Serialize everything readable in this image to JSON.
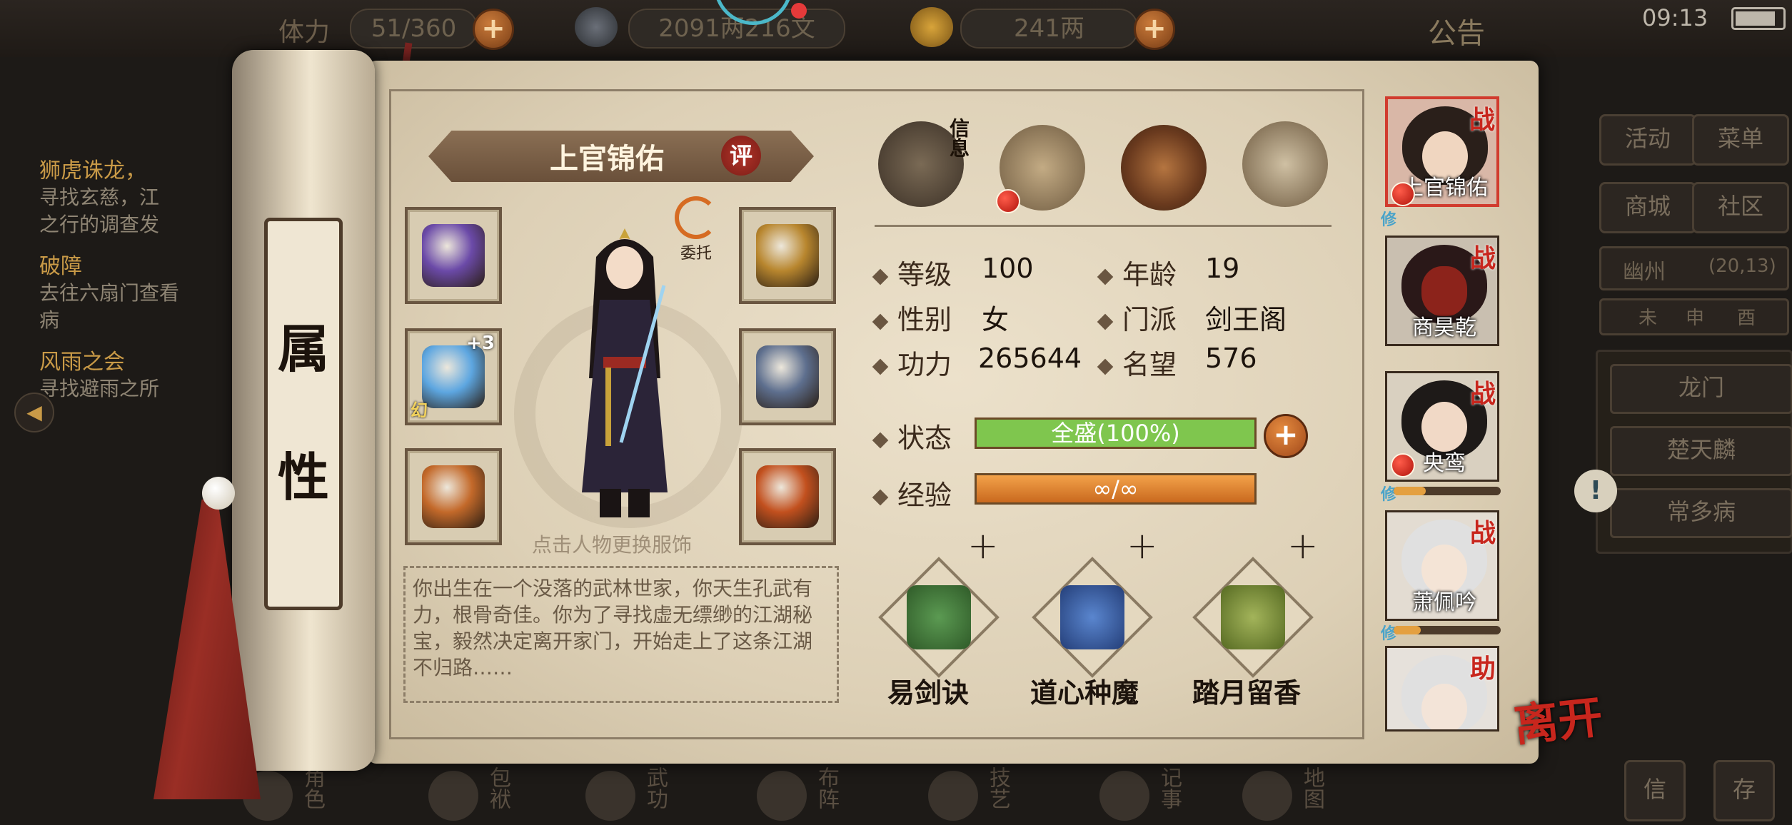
{
  "topbar": {
    "stamina_label": "体力",
    "stamina_value": "51/360",
    "money_value": "2091两216文",
    "gold_value": "241两",
    "notice_label": "公告",
    "clock": "09:13"
  },
  "quests": [
    {
      "title": "狮虎诛龙，",
      "desc": "寻找玄慈，江\n之行的调查发"
    },
    {
      "title": "破障",
      "desc": "去往六扇门查看\n病"
    },
    {
      "title": "风雨之会",
      "desc": "寻找避雨之所"
    }
  ],
  "scroll_tab": {
    "line1": "属",
    "line2": "性"
  },
  "character": {
    "name": "上官锦佑",
    "review_label": "评",
    "delegate_label": "委托",
    "hint": "点击人物更换服饰",
    "bio": "你出生在一个没落的武林世家，你天生孔武有力，根骨奇佳。你为了寻找虚无缥缈的江湖秘宝，毅然决定离开家门，开始走上了这条江湖不归路……"
  },
  "equipment": {
    "left": [
      {
        "icon": "gauntlet-icon",
        "color": "#6b4aa8"
      },
      {
        "icon": "sword-icon",
        "color": "#5da6e0",
        "badge": "+3",
        "badge2": "幻"
      },
      {
        "icon": "ring-icon",
        "color": "#c3692a"
      }
    ],
    "right": [
      {
        "icon": "bracelet-icon",
        "color": "#b8862e"
      },
      {
        "icon": "armor-icon",
        "color": "#5e6f8e"
      },
      {
        "icon": "amulet-icon",
        "color": "#c2501e"
      }
    ]
  },
  "tabs": [
    {
      "name": "info",
      "label": "信息",
      "color": "#6a5641"
    },
    {
      "name": "map",
      "label": "",
      "color": "#a08a6a"
    },
    {
      "name": "bagua",
      "label": "",
      "color": "#7a4a2a"
    },
    {
      "name": "meridian",
      "label": "",
      "color": "#a08a6a"
    }
  ],
  "stats": {
    "level_label": "等级",
    "level_value": "100",
    "age_label": "年龄",
    "age_value": "19",
    "gender_label": "性别",
    "gender_value": "女",
    "sect_label": "门派",
    "sect_value": "剑王阁",
    "power_label": "功力",
    "power_value": "265644",
    "fame_label": "名望",
    "fame_value": "576",
    "status_label": "状态",
    "status_value": "全盛(100%)",
    "status_fraction": 1.0,
    "exp_label": "经验",
    "exp_value": "∞/∞"
  },
  "skills": [
    {
      "name": "易剑诀",
      "color": "#3f7a3a"
    },
    {
      "name": "道心种魔",
      "color": "#3a5fa6"
    },
    {
      "name": "踏月留香",
      "color": "#6f8a3a"
    }
  ],
  "roster": [
    {
      "name": "上官锦佑",
      "role": "战",
      "selected": true,
      "face": "#2a1f1a",
      "skin": "#f0d6c0",
      "xiu": "修"
    },
    {
      "name": "商昊乾",
      "role": "战",
      "selected": false,
      "face": "#3a1a1a",
      "skin": "#9a2a20",
      "xiu": ""
    },
    {
      "name": "央鸾",
      "role": "战",
      "selected": false,
      "face": "#1e1a18",
      "skin": "#f1d9c6",
      "xiu": "修"
    },
    {
      "name": "萧佩吟",
      "role": "战",
      "selected": false,
      "face": "#dcdcdc",
      "skin": "#f4e4d6",
      "xiu": "修"
    },
    {
      "name": "",
      "role": "助",
      "selected": false,
      "face": "#e0e0e0",
      "skin": "#f3e4d8",
      "xiu": ""
    }
  ],
  "leave_label": "离开",
  "side_menu": {
    "activity": "活动",
    "menu": "菜单",
    "mall": "商城",
    "community": "社区",
    "region": "幽州",
    "coords": "(20,13)",
    "time_left": "未",
    "time_mid": "申",
    "time_right": "酉",
    "npcs": [
      "龙门",
      "楚天麟",
      "常多病"
    ],
    "bottom_a": "信",
    "bottom_b": "存"
  },
  "bottom_nav": [
    "角色",
    "包袱",
    "武功",
    "布阵",
    "技艺",
    "记事",
    "地图"
  ]
}
